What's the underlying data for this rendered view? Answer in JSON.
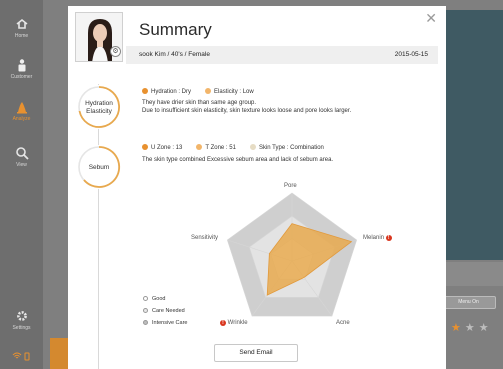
{
  "sidebar": {
    "items": [
      {
        "label": "Home",
        "icon": "home-icon"
      },
      {
        "label": "Customer",
        "icon": "customer-icon"
      },
      {
        "label": "Analyze",
        "icon": "analyze-icon",
        "active": true
      },
      {
        "label": "View",
        "icon": "magnifier-icon"
      },
      {
        "label": "Settings",
        "icon": "gear-icon"
      }
    ]
  },
  "background": {
    "menu_button": "Menu On"
  },
  "modal": {
    "title": "Summary",
    "customer": "sook Kim / 40's / Female",
    "date": "2015-05-15",
    "sections": [
      {
        "circle_line1": "Hydration",
        "circle_line2": "Elasticity",
        "tags": [
          {
            "text": "Hydration : Dry",
            "color": "#e8912f"
          },
          {
            "text": "Elasticity : Low",
            "color": "#f2b56a"
          }
        ],
        "desc_line1": "They have drier skin than same age group.",
        "desc_line2": "Due to insufficient skin elasticity, skin texture looks loose and pore looks larger."
      },
      {
        "circle_line1": "Sebum",
        "tags": [
          {
            "text": "U Zone : 13",
            "color": "#e8912f"
          },
          {
            "text": "T Zone : 51",
            "color": "#f2b56a"
          },
          {
            "text": "Skin Type : Combination",
            "color": "#e6dcc4"
          }
        ],
        "desc_line1": "The skin type combined Excessive sebum area and lack of sebum area."
      }
    ],
    "radar": {
      "axes": [
        "Pore",
        "Melanin",
        "Acne",
        "Wrinkle",
        "Sensitivity"
      ],
      "warnings": [
        "Melanin",
        "Wrinkle"
      ],
      "levels": [
        "Good",
        "Care Needed",
        "Intensive Care"
      ],
      "values": [
        0.55,
        0.92,
        0.3,
        0.62,
        0.35
      ],
      "fill_color": "#e8a94e"
    },
    "send_button": "Send Email"
  }
}
